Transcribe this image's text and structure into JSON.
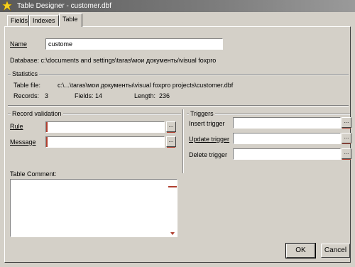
{
  "window": {
    "title": "Table Designer - customer.dbf"
  },
  "tabs": [
    {
      "label": "Fields"
    },
    {
      "label": "Indexes"
    },
    {
      "label": "Table"
    }
  ],
  "table": {
    "name_label": "Name",
    "name_value": "custome",
    "database_text": "Database: c:\\documents and settings\\taras\\мои документы\\visual foxpro",
    "statistics": {
      "title": "Statistics",
      "table_file_label": "Table file:",
      "table_file_value": "c:\\...\\taras\\мои документы\\visual foxpro projects\\customer.dbf",
      "records_label": "Records:",
      "records_value": "3",
      "fields_label": "Fields:",
      "fields_value": "14",
      "length_label": "Length:",
      "length_value": "236"
    },
    "record_validation": {
      "title": "Record validation",
      "rule_label": "Rule",
      "rule_value": "",
      "message_label": "Message",
      "message_value": ""
    },
    "triggers": {
      "title": "Triggers",
      "insert_label": "Insert trigger",
      "update_label": "Update trigger",
      "delete_label": "Delete trigger"
    },
    "comment": {
      "label": "Table Comment:",
      "value": ""
    },
    "dots_label": "..."
  },
  "buttons": {
    "ok": "OK",
    "cancel": "Cancel"
  }
}
